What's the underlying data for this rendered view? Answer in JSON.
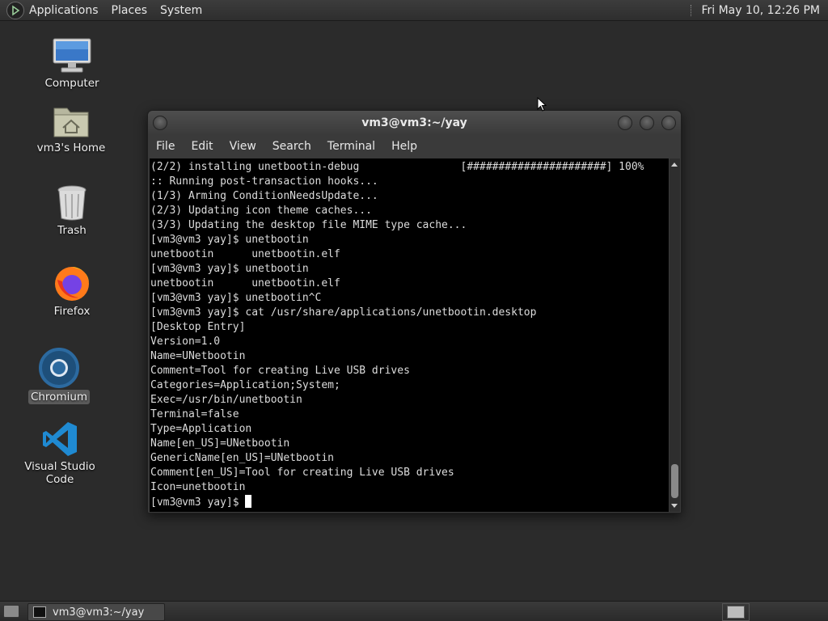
{
  "top_panel": {
    "menus": [
      "Applications",
      "Places",
      "System"
    ],
    "clock": "Fri May 10, 12:26 PM"
  },
  "desktop_icons": [
    {
      "label": "Computer",
      "icon": "computer-icon"
    },
    {
      "label": "vm3's Home",
      "icon": "home-folder-icon"
    },
    {
      "label": "Trash",
      "icon": "trash-icon"
    },
    {
      "label": "Firefox",
      "icon": "firefox-icon"
    },
    {
      "label": "Chromium",
      "icon": "chromium-icon",
      "selected": true
    },
    {
      "label": "Visual Studio Code",
      "icon": "vscode-icon"
    }
  ],
  "terminal": {
    "title": "vm3@vm3:~/yay",
    "menu": [
      "File",
      "Edit",
      "View",
      "Search",
      "Terminal",
      "Help"
    ],
    "lines": [
      "(2/2) installing unetbootin-debug                [######################] 100%",
      ":: Running post-transaction hooks...",
      "(1/3) Arming ConditionNeedsUpdate...",
      "(2/3) Updating icon theme caches...",
      "(3/3) Updating the desktop file MIME type cache...",
      "[vm3@vm3 yay]$ unetbootin",
      "unetbootin      unetbootin.elf",
      "[vm3@vm3 yay]$ unetbootin",
      "unetbootin      unetbootin.elf",
      "[vm3@vm3 yay]$ unetbootin^C",
      "[vm3@vm3 yay]$ cat /usr/share/applications/unetbootin.desktop",
      "[Desktop Entry]",
      "Version=1.0",
      "Name=UNetbootin",
      "Comment=Tool for creating Live USB drives",
      "Categories=Application;System;",
      "Exec=/usr/bin/unetbootin",
      "Terminal=false",
      "Type=Application",
      "Name[en_US]=UNetbootin",
      "GenericName[en_US]=UNetbootin",
      "Comment[en_US]=Tool for creating Live USB drives",
      "Icon=unetbootin"
    ],
    "prompt": "[vm3@vm3 yay]$ "
  },
  "bottom_panel": {
    "taskbar_label": "vm3@vm3:~/yay"
  }
}
